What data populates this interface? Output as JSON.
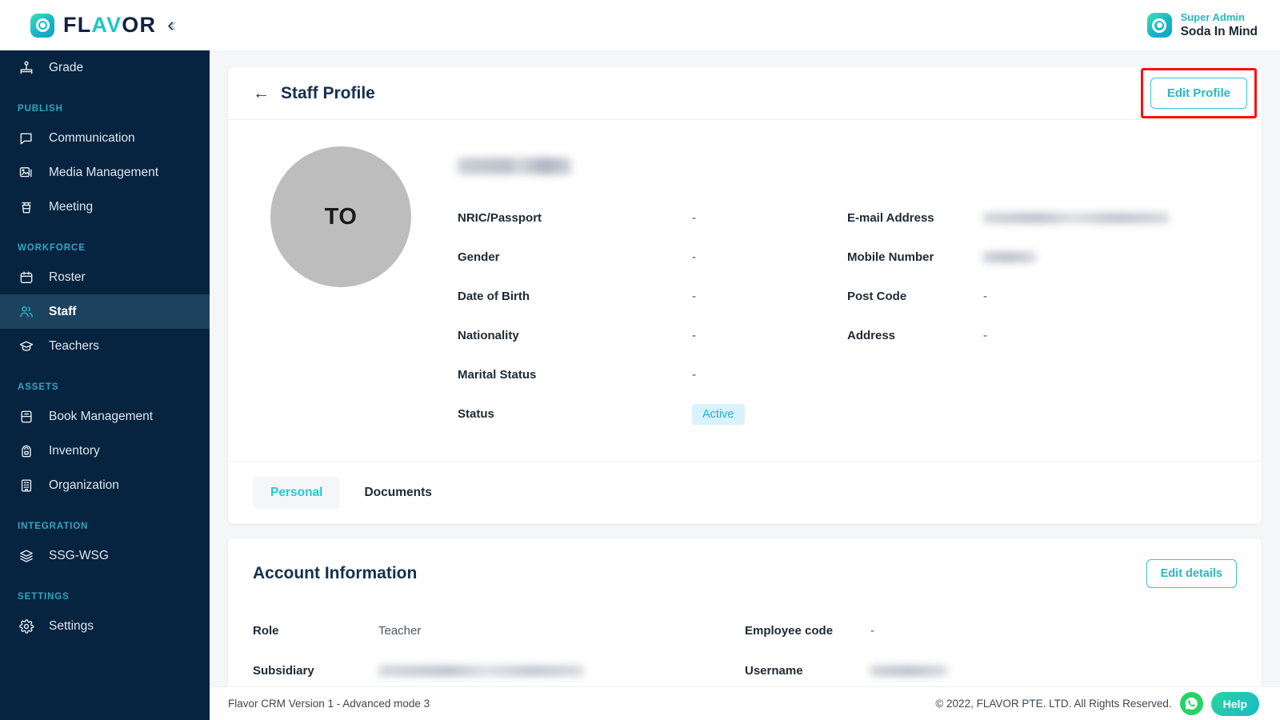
{
  "brand": {
    "word_dark_1": "FL",
    "word_accent": "AV",
    "word_dark_2": "OR",
    "full": "FLAVOR"
  },
  "topbar": {
    "user_role": "Super Admin",
    "user_name": "Soda In Mind"
  },
  "sidebar": {
    "items_top": [
      {
        "label": "Grade",
        "icon": "grade-icon",
        "active": false
      }
    ],
    "sections": [
      {
        "title": "PUBLISH",
        "items": [
          {
            "label": "Communication",
            "icon": "chat-icon",
            "active": false
          },
          {
            "label": "Media Management",
            "icon": "media-icon",
            "active": false
          },
          {
            "label": "Meeting",
            "icon": "podium-icon",
            "active": false
          }
        ]
      },
      {
        "title": "WORKFORCE",
        "items": [
          {
            "label": "Roster",
            "icon": "calendar-icon",
            "active": false
          },
          {
            "label": "Staff",
            "icon": "users-icon",
            "active": true
          },
          {
            "label": "Teachers",
            "icon": "graduation-cap-icon",
            "active": false
          }
        ]
      },
      {
        "title": "ASSETS",
        "items": [
          {
            "label": "Book Management",
            "icon": "book-icon",
            "active": false
          },
          {
            "label": "Inventory",
            "icon": "backpack-icon",
            "active": false
          },
          {
            "label": "Organization",
            "icon": "building-icon",
            "active": false
          }
        ]
      },
      {
        "title": "INTEGRATION",
        "items": [
          {
            "label": "SSG-WSG",
            "icon": "layers-icon",
            "active": false
          }
        ]
      },
      {
        "title": "SETTINGS",
        "items": [
          {
            "label": "Settings",
            "icon": "gear-icon",
            "active": false
          }
        ]
      }
    ]
  },
  "page": {
    "title": "Staff Profile",
    "edit_profile_label": "Edit Profile"
  },
  "profile": {
    "avatar_initials": "TO",
    "name": "",
    "fields_left": [
      {
        "label": "NRIC/Passport",
        "value": "-"
      },
      {
        "label": "Gender",
        "value": "-"
      },
      {
        "label": "Date of Birth",
        "value": "-"
      },
      {
        "label": "Nationality",
        "value": "-"
      },
      {
        "label": "Marital Status",
        "value": "-"
      }
    ],
    "status_label": "Status",
    "status_value": "Active",
    "fields_right": [
      {
        "label": "E-mail Address",
        "value": ""
      },
      {
        "label": "Mobile Number",
        "value": ""
      },
      {
        "label": "Post Code",
        "value": "-"
      },
      {
        "label": "Address",
        "value": "-"
      }
    ]
  },
  "tabs": [
    {
      "label": "Personal",
      "active": true
    },
    {
      "label": "Documents",
      "active": false
    }
  ],
  "account": {
    "title": "Account Information",
    "edit_details_label": "Edit details",
    "rows": [
      {
        "l_label": "Role",
        "l_value": "Teacher",
        "r_label": "Employee code",
        "r_value": "-"
      },
      {
        "l_label": "Subsidiary",
        "l_value": "",
        "r_label": "Username",
        "r_value": ""
      }
    ]
  },
  "footer": {
    "version": "Flavor CRM Version 1 - Advanced mode 3",
    "copyright": "© 2022, FLAVOR PTE. LTD. All Rights Reserved.",
    "help_label": "Help"
  },
  "colors": {
    "sidebar_bg": "#06233f",
    "sidebar_active": "#1d4260",
    "accent_teal": "#2bb7c4",
    "title_navy": "#16304d",
    "badge_bg": "#d9f2fb",
    "badge_text": "#30a9e0",
    "highlight_red": "#fb0f0f",
    "whatsapp_green": "#25d366"
  }
}
